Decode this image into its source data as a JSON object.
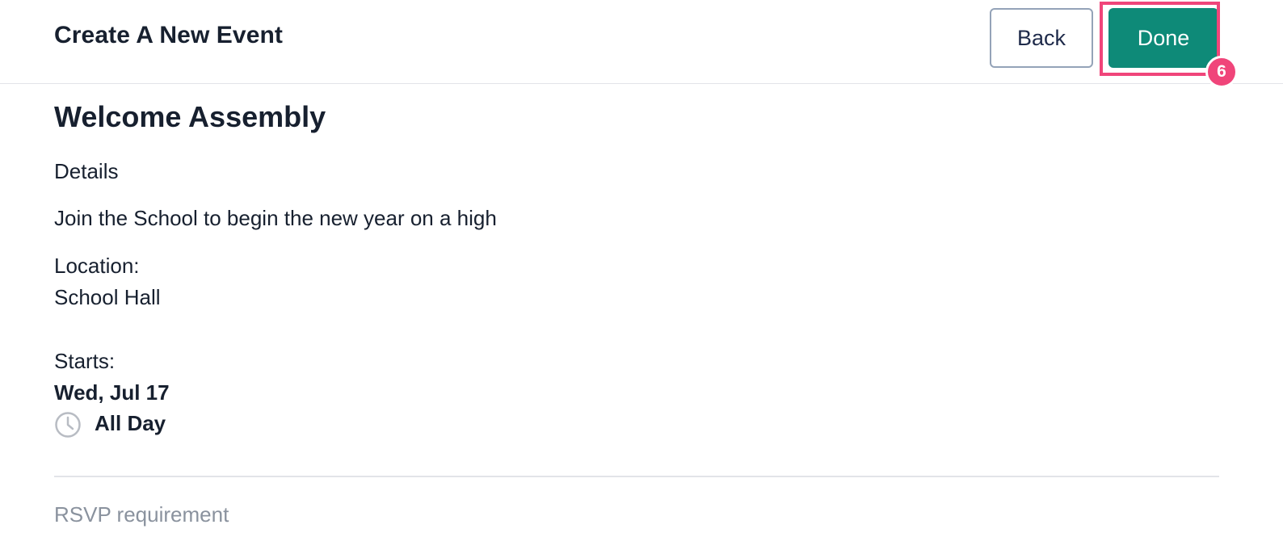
{
  "header": {
    "title": "Create A New Event",
    "back_label": "Back",
    "done_label": "Done",
    "step_badge": "6"
  },
  "event": {
    "title": "Welcome Assembly",
    "details_label": "Details",
    "description": "Join the School to begin the new year on a high",
    "location_label": "Location:",
    "location_value": "School Hall",
    "starts_label": "Starts:",
    "start_date": "Wed, Jul 17",
    "time_icon": "clock-icon",
    "start_time": "All Day",
    "rsvp_label": "RSVP requirement"
  },
  "colors": {
    "accent": "#0e8a78",
    "highlight": "#f0457a",
    "text": "#17202f",
    "muted": "#8a929e"
  }
}
